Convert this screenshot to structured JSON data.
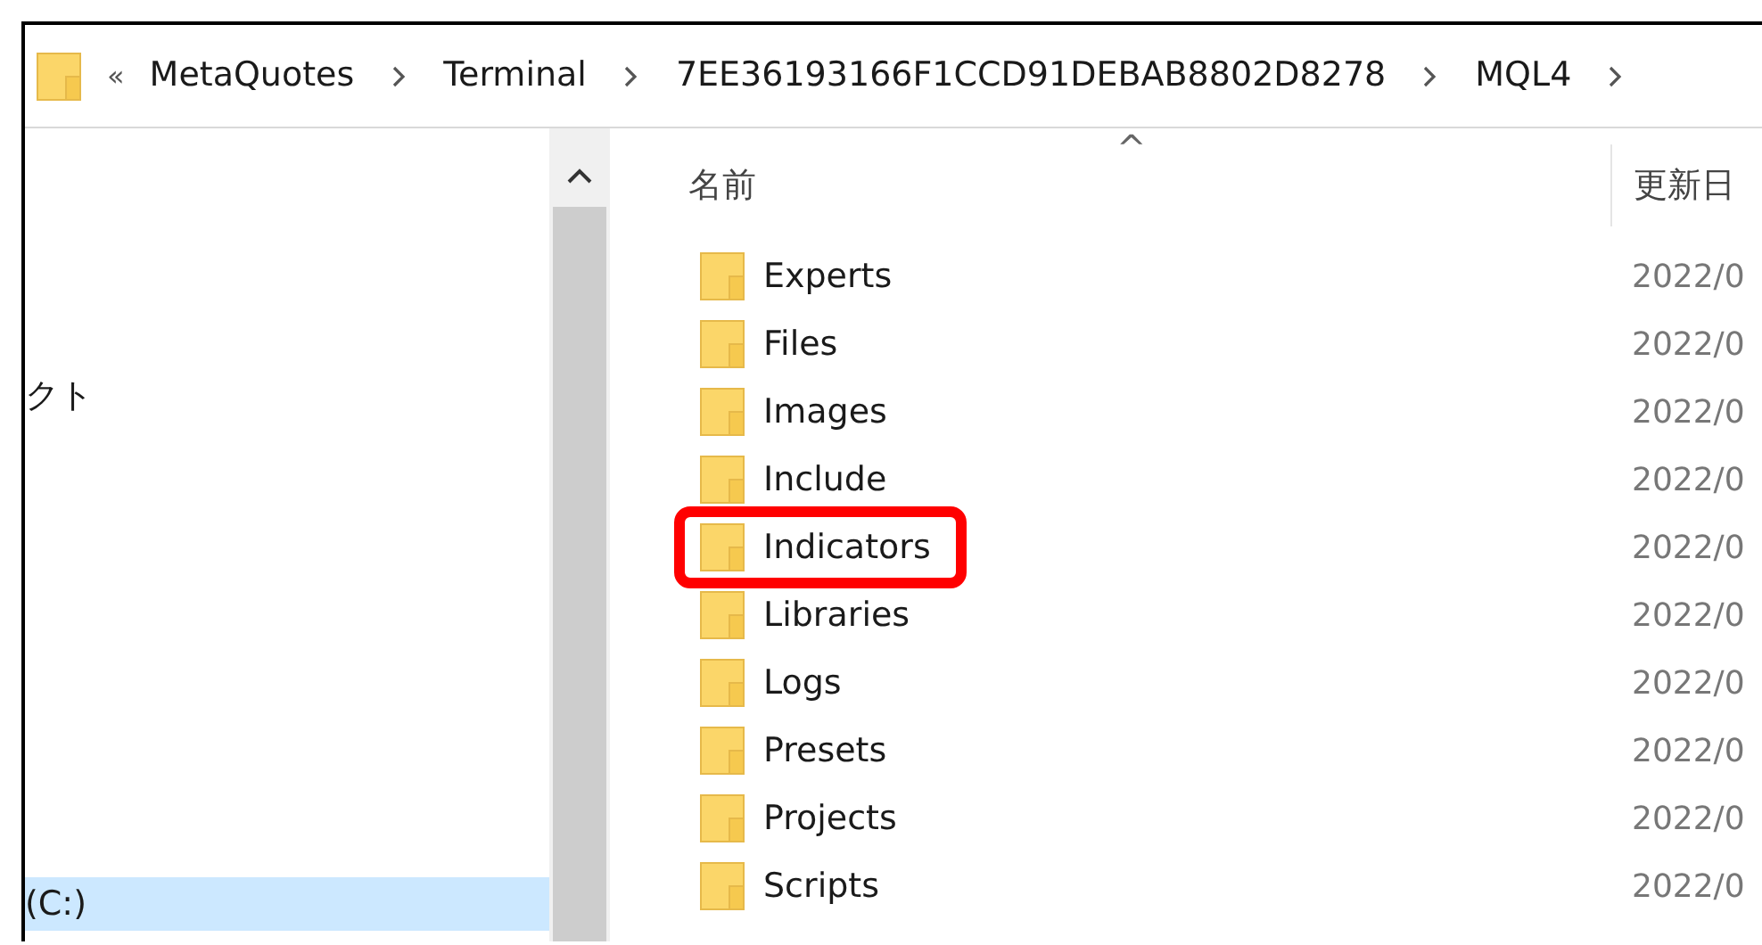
{
  "address_bar": {
    "overflow": "«",
    "path": [
      "MetaQuotes",
      "Terminal",
      "7EE36193166F1CCD91DEBAB8802D8278",
      "MQL4"
    ]
  },
  "nav_pane": {
    "items": [
      {
        "label": "クト",
        "selected": false
      },
      {
        "label": "(C:)",
        "selected": true
      }
    ]
  },
  "file_list": {
    "sort_indicator": "^",
    "columns": [
      "名前",
      "更新日"
    ],
    "rows": [
      {
        "name": "Experts",
        "date": "2022/0",
        "highlighted": false
      },
      {
        "name": "Files",
        "date": "2022/0",
        "highlighted": false
      },
      {
        "name": "Images",
        "date": "2022/0",
        "highlighted": false
      },
      {
        "name": "Include",
        "date": "2022/0",
        "highlighted": false
      },
      {
        "name": "Indicators",
        "date": "2022/0",
        "highlighted": true
      },
      {
        "name": "Libraries",
        "date": "2022/0",
        "highlighted": false
      },
      {
        "name": "Logs",
        "date": "2022/0",
        "highlighted": false
      },
      {
        "name": "Presets",
        "date": "2022/0",
        "highlighted": false
      },
      {
        "name": "Projects",
        "date": "2022/0",
        "highlighted": false
      },
      {
        "name": "Scripts",
        "date": "2022/0",
        "highlighted": false
      }
    ]
  }
}
